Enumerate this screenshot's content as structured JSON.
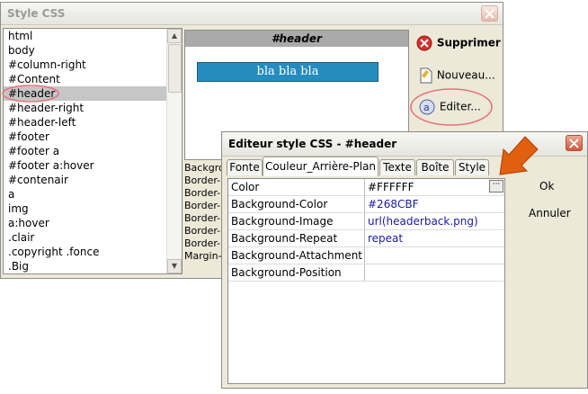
{
  "style_window": {
    "title": "Style CSS",
    "selectors": [
      "html",
      "body",
      "#column-right",
      "#Content",
      "#header",
      "#header-right",
      "#header-left",
      "#footer",
      "#footer a",
      "#footer a:hover",
      "#contenair",
      "a",
      "img",
      "a:hover",
      ".clair",
      ".copyright .fonce",
      ".Big"
    ],
    "selected_index": 4,
    "preview_title": "#header",
    "preview_text": "bla bla bla",
    "buttons": {
      "delete": "Supprimer",
      "new": "Nouveau...",
      "edit": "Editer..."
    },
    "property_lines": [
      "Backgro",
      "Border-",
      "Border-",
      "Border-",
      "Border-",
      "Border-",
      "Border-",
      "Margin-"
    ]
  },
  "editor_window": {
    "title": "Editeur style CSS - #header",
    "tabs": [
      "Fonte",
      "Couleur_Arrière-Plan",
      "Texte",
      "Boîte",
      "Style"
    ],
    "active_tab": 1,
    "rows": [
      {
        "name": "Color",
        "value": "#FFFFFF"
      },
      {
        "name": "Background-Color",
        "value": "#268CBF"
      },
      {
        "name": "Background-Image",
        "value": "url(headerback.png)"
      },
      {
        "name": "Background-Repeat",
        "value": "repeat"
      },
      {
        "name": "Background-Attachment",
        "value": ""
      },
      {
        "name": "Background-Position",
        "value": ""
      }
    ],
    "ok_label": "Ok",
    "cancel_label": "Annuler"
  },
  "colors": {
    "preview_bg": "#268CBF",
    "highlight_oval": "#e8707a",
    "arrow": "#e06010"
  },
  "icons": {
    "close": "close-icon",
    "delete": "delete-icon",
    "new": "new-document-icon",
    "edit": "edit-icon",
    "arrow": "pointer-arrow-icon",
    "ellipsis": "ellipsis-button"
  }
}
